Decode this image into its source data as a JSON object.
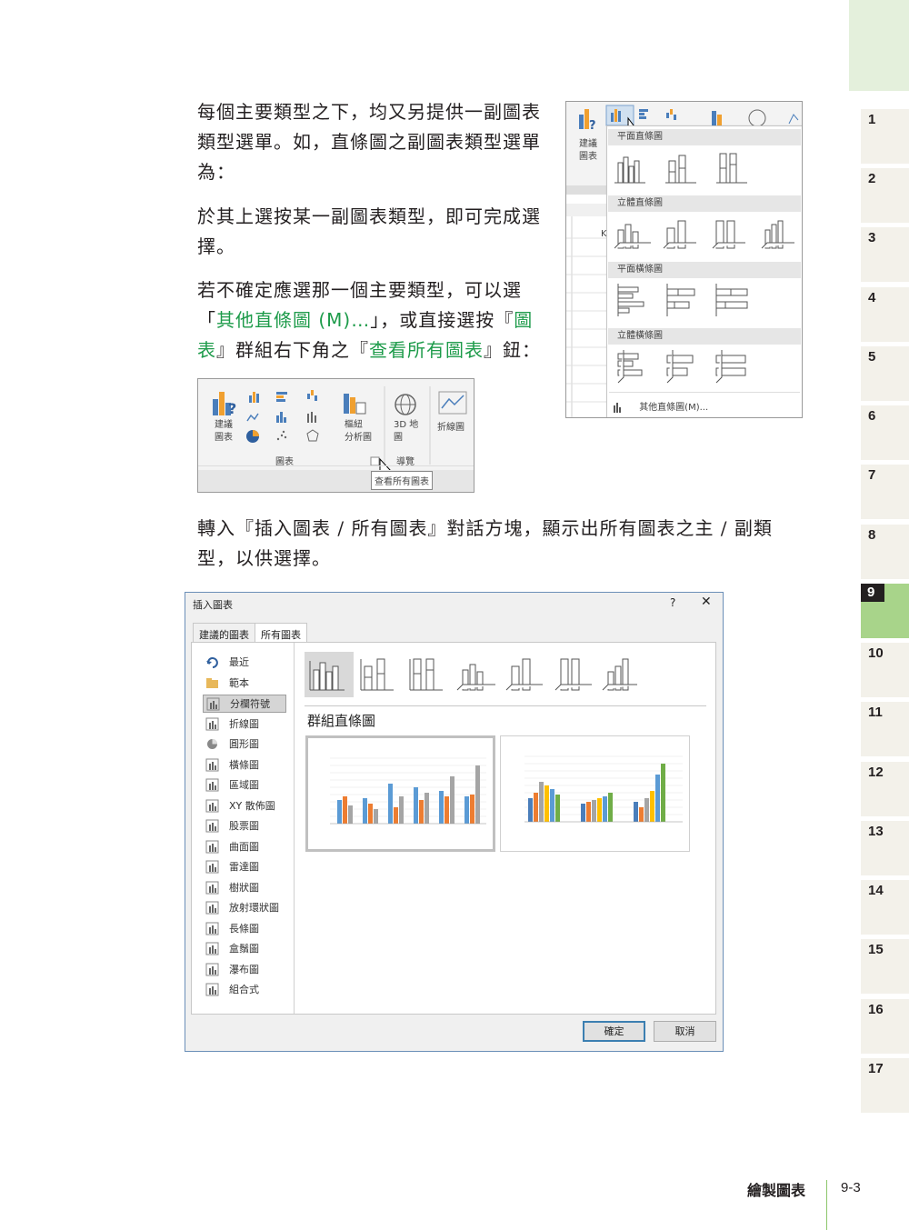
{
  "paragraphs": {
    "p1": "每個主要類型之下，均又另提供一副圖表類型選單。如，直條圖之副圖表類型選單為：",
    "p2": "於其上選按某一副圖表類型，即可完成選擇。",
    "p3a": "若不確定應選那一個主要類型，可以選",
    "p3b": "「",
    "p3c": "其他直條圖 (M)…",
    "p3d": "」，或直接選按『",
    "p3e": "圖表",
    "p3f": "』群組右下角之『",
    "p3g": "查看所有圖表",
    "p3h": "』鈕：",
    "p4": "轉入『插入圖表 / 所有圖表』對話方塊，顯示出所有圖表之主 / 副類型，以供選擇。"
  },
  "ribbon": {
    "recommended_l1": "建議",
    "recommended_l2": "圖表",
    "pivot_l1": "樞紐",
    "pivot_l2": "分析圖",
    "map3d_l1": "3D 地",
    "map3d_l2": "圖",
    "line": "折線圖",
    "group_charts": "圖表",
    "group_tours": "導覽",
    "tooltip": "查看所有圖表"
  },
  "submenu": {
    "recommended_l1": "建議",
    "recommended_l2": "圖表",
    "head_2d_column": "平面直條圖",
    "head_3d_column": "立體直條圖",
    "head_2d_bar": "平面橫條圖",
    "head_3d_bar": "立體橫條圖",
    "more": "其他直條圖(M)...",
    "cell_letter": "K"
  },
  "dialog": {
    "title": "插入圖表",
    "help": "?",
    "close": "✕",
    "tab_recommended": "建議的圖表",
    "tab_all": "所有圖表",
    "categories": [
      "最近",
      "範本",
      "分欄符號",
      "折線圖",
      "圓形圖",
      "橫條圖",
      "區域圖",
      "XY 散佈圖",
      "股票圖",
      "曲面圖",
      "雷達圖",
      "樹狀圖",
      "放射環狀圖",
      "長條圖",
      "盒鬚圖",
      "瀑布圖",
      "組合式"
    ],
    "selected_category": "分欄符號",
    "subtype_title": "群組直條圖",
    "ok": "確定",
    "cancel": "取消"
  },
  "footer": {
    "chapter_title": "繪製圖表",
    "page": "9-3"
  },
  "chapter_tabs": [
    "1",
    "2",
    "3",
    "4",
    "5",
    "6",
    "7",
    "8",
    "9",
    "10",
    "11",
    "12",
    "13",
    "14",
    "15",
    "16",
    "17"
  ],
  "active_chapter": "9",
  "colors": {
    "accent_green": "#1d9b4a",
    "tab_active": "#a8d48a",
    "series_blue": "#4a7ebb",
    "series_orange": "#ed7d31",
    "series_gray": "#a5a5a5",
    "series_yellow": "#ffc000",
    "series_lightblue": "#5b9bd5",
    "series_green": "#70ad47"
  }
}
